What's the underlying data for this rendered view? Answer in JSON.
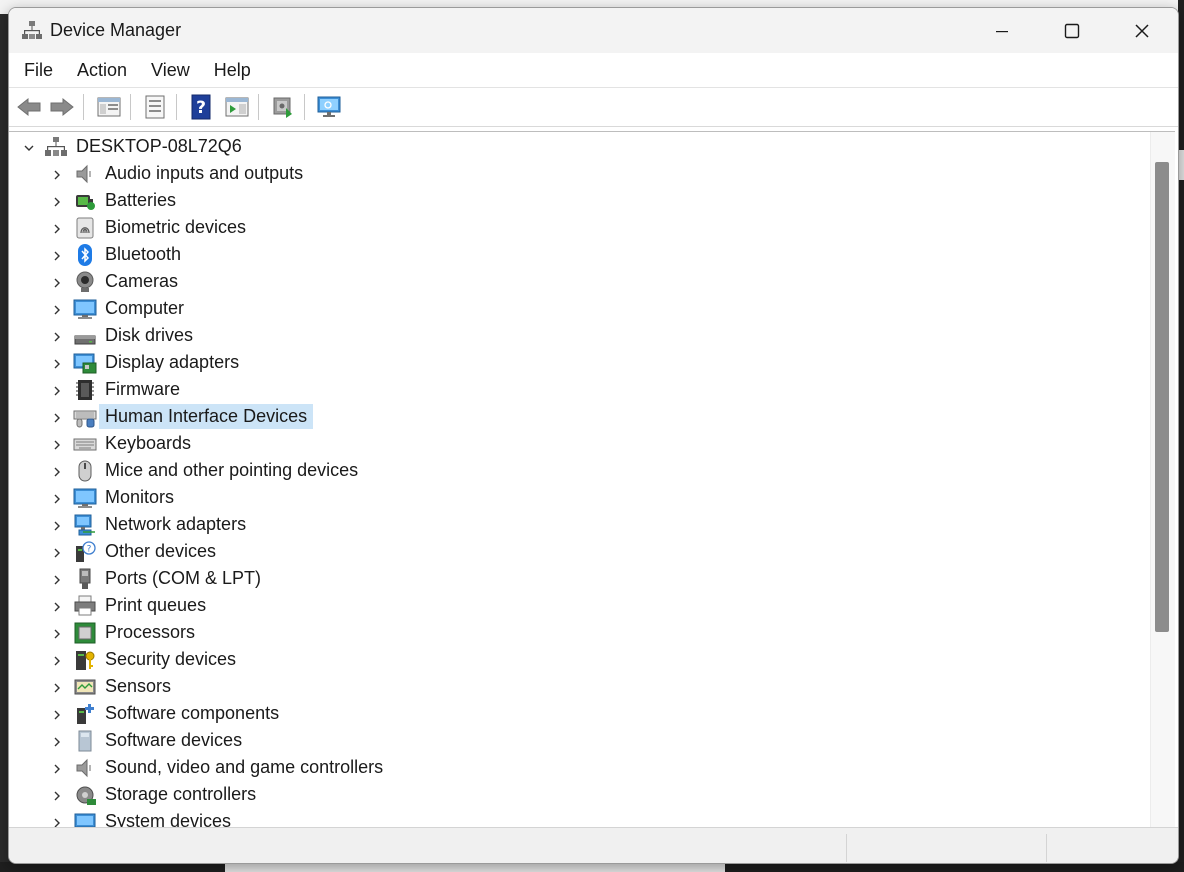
{
  "window": {
    "title": "Device Manager",
    "minimize_label": "Minimize",
    "maximize_label": "Maximize",
    "close_label": "Close"
  },
  "menu": {
    "items": [
      "File",
      "Action",
      "View",
      "Help"
    ]
  },
  "toolbar": {
    "buttons": [
      "back-icon",
      "forward-icon",
      "show-hide-console-tree-icon",
      "properties-icon",
      "help-icon",
      "show-hide-action-pane-icon",
      "scan-hardware-icon",
      "monitor-icon"
    ]
  },
  "tree": {
    "root": "DESKTOP-08L72Q6",
    "categories": [
      {
        "label": "Audio inputs and outputs",
        "icon": "speaker-icon"
      },
      {
        "label": "Batteries",
        "icon": "battery-icon"
      },
      {
        "label": "Biometric devices",
        "icon": "fingerprint-icon"
      },
      {
        "label": "Bluetooth",
        "icon": "bluetooth-icon"
      },
      {
        "label": "Cameras",
        "icon": "camera-icon"
      },
      {
        "label": "Computer",
        "icon": "computer-icon"
      },
      {
        "label": "Disk drives",
        "icon": "disk-drive-icon"
      },
      {
        "label": "Display adapters",
        "icon": "display-adapter-icon"
      },
      {
        "label": "Firmware",
        "icon": "firmware-chip-icon"
      },
      {
        "label": "Human Interface Devices",
        "icon": "hid-icon",
        "selected": true
      },
      {
        "label": "Keyboards",
        "icon": "keyboard-icon"
      },
      {
        "label": "Mice and other pointing devices",
        "icon": "mouse-icon"
      },
      {
        "label": "Monitors",
        "icon": "monitor-icon"
      },
      {
        "label": "Network adapters",
        "icon": "network-adapter-icon"
      },
      {
        "label": "Other devices",
        "icon": "unknown-device-icon"
      },
      {
        "label": "Ports (COM & LPT)",
        "icon": "port-icon"
      },
      {
        "label": "Print queues",
        "icon": "printer-icon"
      },
      {
        "label": "Processors",
        "icon": "processor-icon"
      },
      {
        "label": "Security devices",
        "icon": "security-key-icon"
      },
      {
        "label": "Sensors",
        "icon": "sensor-icon"
      },
      {
        "label": "Software components",
        "icon": "software-component-icon"
      },
      {
        "label": "Software devices",
        "icon": "software-device-icon"
      },
      {
        "label": "Sound, video and game controllers",
        "icon": "speaker-icon"
      },
      {
        "label": "Storage controllers",
        "icon": "storage-controller-icon"
      },
      {
        "label": "System devices",
        "icon": "system-device-icon"
      }
    ]
  },
  "colors": {
    "selection": "#cce4f7",
    "accent": "#0078d4"
  }
}
